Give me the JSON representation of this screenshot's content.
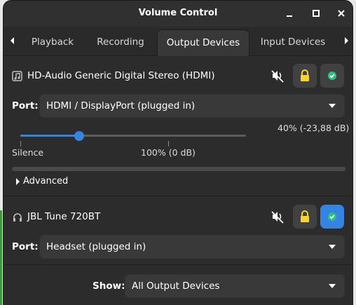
{
  "window": {
    "title": "Volume Control"
  },
  "tabs": [
    {
      "label": "Playback"
    },
    {
      "label": "Recording"
    },
    {
      "label": "Output Devices"
    },
    {
      "label": "Input Devices"
    }
  ],
  "active_tab": "Output Devices",
  "devices": [
    {
      "name": "HD-Audio Generic Digital Stereo (HDMI)",
      "icon": "music-note-icon",
      "port_label": "Port:",
      "port_value": "HDMI / DisplayPort (plugged in)",
      "volume_readout": "40% (-23,88 dB)",
      "volume_level_fraction": 0.26,
      "silence_label": "Silence",
      "hundred_label": "100% (0 dB)",
      "peak_meter_fraction": 0.0,
      "advanced_label": "Advanced",
      "muted": true,
      "locked": true,
      "is_default": false
    },
    {
      "name": "JBL Tune 720BT",
      "icon": "headphones-icon",
      "port_label": "Port:",
      "port_value": "Headset (plugged in)",
      "muted": true,
      "locked": true,
      "is_default": true
    }
  ],
  "footer": {
    "show_label": "Show:",
    "show_value": "All Output Devices"
  },
  "colors": {
    "accent": "#3584e4",
    "lock_yellow": "#f6d32d",
    "check_green": "#2ec27e",
    "window_bg": "#2c2c2c"
  }
}
